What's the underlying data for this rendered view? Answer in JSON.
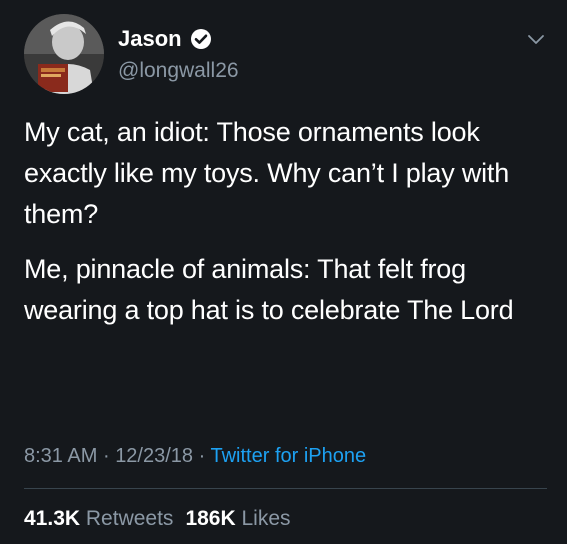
{
  "author": {
    "display_name": "Jason",
    "handle": "@longwall26",
    "verified": true,
    "avatar": "profile-photo"
  },
  "icons": {
    "verified": "verified-badge-icon",
    "menu": "chevron-down-icon"
  },
  "tweet": {
    "paragraphs": [
      "My cat, an idiot: Those ornaments look exactly like my toys. Why can’t I play with them?",
      "Me, pinnacle of animals: That felt frog wearing a top hat is to celebrate The Lord"
    ],
    "time": "8:31 AM",
    "date": "12/23/18",
    "separator": "·",
    "source": "Twitter for iPhone"
  },
  "stats": {
    "retweets_count": "41.3K",
    "retweets_label": "Retweets",
    "likes_count": "186K",
    "likes_label": "Likes"
  },
  "colors": {
    "background": "#15181c",
    "text_primary": "#ffffff",
    "text_secondary": "#8b98a5",
    "link": "#1da1f2",
    "divider": "#38444d"
  }
}
